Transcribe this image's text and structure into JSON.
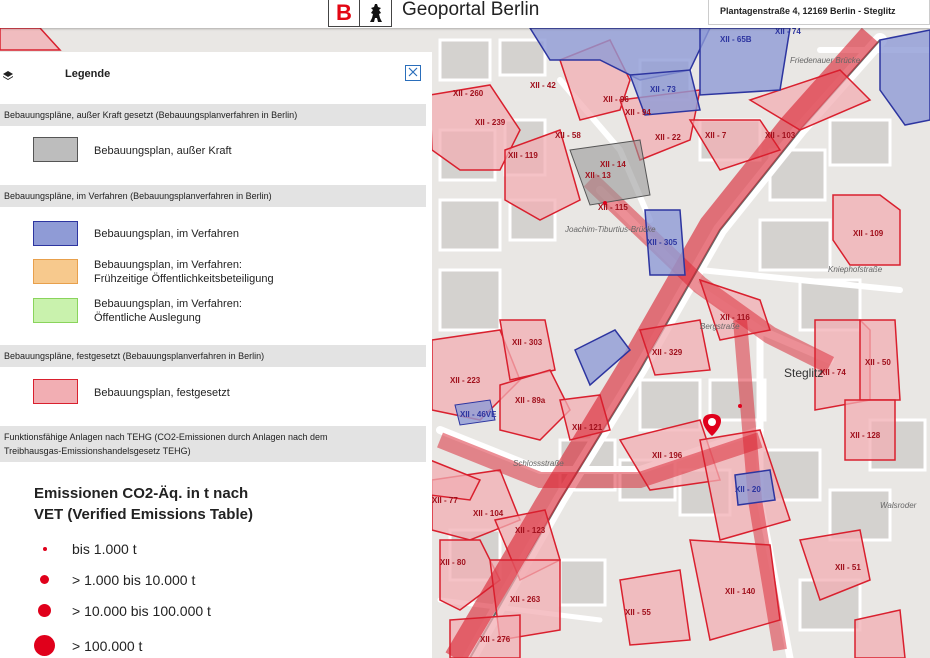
{
  "header": {
    "logo_letter": "B",
    "portal_title": "Geoportal Berlin",
    "address": "Plantagenstraße 4, 12169 Berlin - Steglitz"
  },
  "legend": {
    "title": "Legende",
    "close_icon": "close-x",
    "layers_icon": "layers-stack",
    "sections": [
      {
        "label": "Bebauungspläne, außer Kraft gesetzt (Bebauungsplanverfahren in Berlin)"
      },
      {
        "label": "Bebauungspläne, im Verfahren (Bebauungsplanverfahren in Berlin)"
      },
      {
        "label": "Bebauungspläne, festgesetzt (Bebauungsplanverfahren in Berlin)"
      },
      {
        "label": "Funktionsfähige Anlagen nach TEHG (CO2-Emissionen durch Anlagen nach dem Treibhausgas-Emissionshandelsgesetz TEHG)"
      }
    ],
    "entries": [
      {
        "label": "Bebauungsplan, außer Kraft",
        "fill": "#bdbdbd",
        "stroke": "#555555"
      },
      {
        "label": "Bebauungsplan, im Verfahren",
        "fill": "#8f9bd6",
        "stroke": "#2d35a0"
      },
      {
        "label": "Bebauungsplan, im Verfahren: Frühzeitige Öffentlichkeitsbeteiligung",
        "fill": "#f7c98d",
        "stroke": "#e8a04c"
      },
      {
        "label": "Bebauungsplan, im Verfahren: Öffentliche Auslegung",
        "fill": "#c9f2ad",
        "stroke": "#8ad45c"
      },
      {
        "label": "Bebauungsplan, festgesetzt",
        "fill": "#f2aeb3",
        "stroke": "#d9202e"
      }
    ],
    "entry_lines": [
      [
        "Bebauungsplan, im Verfahren:",
        "Frühzeitige Öffentlichkeitsbeteiligung"
      ],
      [
        "Bebauungsplan, im Verfahren:",
        "Öffentliche Auslegung"
      ]
    ],
    "section4_lines": [
      "Funktionsfähige Anlagen nach TEHG (CO2-Emissionen durch Anlagen nach dem",
      "Treibhausgas-Emissionshandelsgesetz TEHG)"
    ],
    "vet_title_lines": [
      "Emissionen CO2-Äq. in t nach",
      "VET (Verified Emissions Table)"
    ],
    "emission_classes": [
      "bis 1.000 t",
      "> 1.000 bis 10.000 t",
      "> 10.000 bis 100.000 t",
      "> 100.000 t"
    ],
    "emission_color": "#e0001b"
  },
  "map": {
    "plan_labels": [
      "XII - 260",
      "XII - 42",
      "XII - 96",
      "XII - 94",
      "XII - 73",
      "XII - 74",
      "XII - 239",
      "XII - 119",
      "XII - 58",
      "XII - 14",
      "XII - 13",
      "XII - 115",
      "XII - 22",
      "XII - 7",
      "XII - 103",
      "XII - 109",
      "XII - 305",
      "XII - 116",
      "XII - 303",
      "XII - 329",
      "XII - 50",
      "XII - 223",
      "XII - 74",
      "XII - 89a",
      "XII - 46VE",
      "XII - 121",
      "XII - 128",
      "XII - 196",
      "XII - 77",
      "XII - 104",
      "XII - 123",
      "XII - 80",
      "XII - 263",
      "XII - 55",
      "XII - 140",
      "XII - 51",
      "XII - 276",
      "XII - 65B",
      "XII - 20"
    ],
    "street_labels": [
      "Friedenauer Brücke",
      "Schlossstraße",
      "Joachim-Tiburtius-Brücke",
      "Bergstraße",
      "Kniephofstraße",
      "Steglitz",
      "Schildhornstraße",
      "Walsroder",
      "Albrechtstraße",
      "Schlossstraße",
      "Steinstraße"
    ],
    "district_label": "Steglitz",
    "marker": "location-pin"
  }
}
